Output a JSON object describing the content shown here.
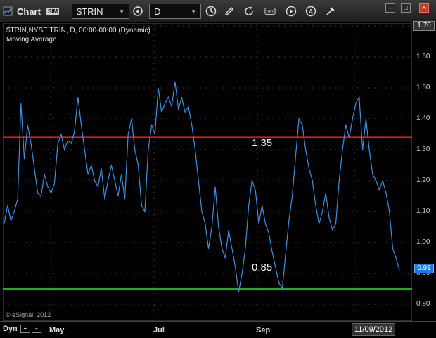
{
  "toolbar": {
    "title": "Chart",
    "sim_badge": "SIM",
    "symbol": "$TRIN",
    "interval": "D",
    "icons": [
      "window-icon",
      "link-icon",
      "clock-icon",
      "pencil-icon",
      "refresh-icon",
      "get-icon",
      "play-icon",
      "text-icon",
      "tools-icon"
    ],
    "get_label": "GET",
    "text_label": "A",
    "win_buttons": [
      "–",
      "□",
      "✕"
    ]
  },
  "legend": {
    "line1": "$TRIN,NYSE TRIN, D, 00:00-00:00 (Dynamic)",
    "line2": "Moving Average"
  },
  "copyright": "© eSignal, 2012",
  "levels": {
    "upper": {
      "label": "1.35",
      "value": 1.34,
      "color": "#e0191b"
    },
    "lower": {
      "label": "0.85",
      "value": 0.85,
      "color": "#19b219"
    }
  },
  "bottom": {
    "dyn": "Dyn",
    "months": [
      "May",
      "Jul",
      "Sep"
    ],
    "current_date": "11/09/2012"
  },
  "yaxis": {
    "top_value": "1.70",
    "last_value": "0.91",
    "ticks": [
      "1.60",
      "1.50",
      "1.40",
      "1.30",
      "1.20",
      "1.10",
      "1.00",
      "0.90",
      "0.80"
    ]
  },
  "chart_data": {
    "type": "line",
    "series": [
      {
        "values": [
          1.06,
          1.12,
          1.07,
          1.1,
          1.14,
          1.45,
          1.27,
          1.38,
          1.32,
          1.24,
          1.16,
          1.15,
          1.22,
          1.18,
          1.16,
          1.19,
          1.32,
          1.35,
          1.3,
          1.33,
          1.32,
          1.36,
          1.47,
          1.38,
          1.3,
          1.22,
          1.25,
          1.2,
          1.18,
          1.24,
          1.14,
          1.2,
          1.25,
          1.2,
          1.15,
          1.22,
          1.14,
          1.35,
          1.4,
          1.3,
          1.25,
          1.12,
          1.1,
          1.3,
          1.38,
          1.35,
          1.5,
          1.42,
          1.45,
          1.47,
          1.44,
          1.52,
          1.43,
          1.47,
          1.42,
          1.44,
          1.38,
          1.3,
          1.2,
          1.1,
          1.06,
          0.98,
          1.05,
          1.18,
          1.05,
          0.98,
          0.95,
          1.04,
          0.98,
          0.92,
          0.84,
          0.9,
          0.98,
          1.12,
          1.2,
          1.17,
          1.06,
          1.12,
          1.06,
          1.03,
          0.97,
          0.92,
          0.87,
          0.85,
          0.96,
          1.07,
          1.15,
          1.28,
          1.4,
          1.38,
          1.3,
          1.24,
          1.2,
          1.12,
          1.06,
          1.1,
          1.16,
          1.08,
          1.04,
          1.06,
          1.2,
          1.3,
          1.38,
          1.34,
          1.4,
          1.45,
          1.47,
          1.3,
          1.4,
          1.3,
          1.22,
          1.2,
          1.17,
          1.2,
          1.16,
          1.1,
          0.98,
          0.95,
          0.91
        ],
        "color": "#3f8fe0"
      }
    ],
    "ylim": [
      0.75,
      1.72
    ],
    "yticks": [
      0.8,
      0.9,
      1.0,
      1.1,
      1.2,
      1.3,
      1.4,
      1.5,
      1.6,
      1.7
    ],
    "xlabel": "",
    "ylabel": "",
    "grid": true
  }
}
